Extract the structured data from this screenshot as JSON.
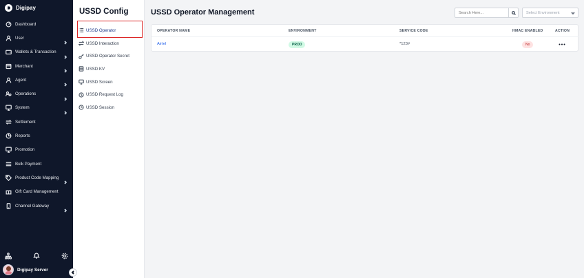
{
  "brand": {
    "name": "Digipay"
  },
  "sidebar": {
    "items": [
      {
        "label": "Dashboard",
        "icon": "speedometer-icon",
        "has_children": false
      },
      {
        "label": "User",
        "icon": "user-icon",
        "has_children": true
      },
      {
        "label": "Wallets & Transaction",
        "icon": "wallet-icon",
        "has_children": true
      },
      {
        "label": "Merchant",
        "icon": "store-icon",
        "has_children": true
      },
      {
        "label": "Agent",
        "icon": "agent-icon",
        "has_children": true
      },
      {
        "label": "Operations",
        "icon": "users-cog-icon",
        "has_children": true
      },
      {
        "label": "System",
        "icon": "monitor-icon",
        "has_children": true
      },
      {
        "label": "Settlement",
        "icon": "swap-icon",
        "has_children": false
      },
      {
        "label": "Reports",
        "icon": "pie-chart-icon",
        "has_children": false
      },
      {
        "label": "Promotion",
        "icon": "screen-icon",
        "has_children": false
      },
      {
        "label": "Bulk Payment",
        "icon": "list-icon",
        "has_children": false
      },
      {
        "label": "Product Code Mapping",
        "icon": "tag-icon",
        "has_children": true
      },
      {
        "label": "Gift Card Management",
        "icon": "gift-icon",
        "has_children": false
      },
      {
        "label": "Channel Gateway",
        "icon": "phone-icon",
        "has_children": true
      }
    ],
    "user_name": "Digipay Server"
  },
  "subpanel": {
    "title": "USSD Config",
    "items": [
      {
        "label": "USSD Operator",
        "icon": "list-icon",
        "active": true
      },
      {
        "label": "USSD Interaction",
        "icon": "swap-icon",
        "active": false
      },
      {
        "label": "USSD Operator Secret",
        "icon": "key-icon",
        "active": false
      },
      {
        "label": "USSD KV",
        "icon": "database-icon",
        "active": false
      },
      {
        "label": "USSD Screen",
        "icon": "monitor-icon",
        "active": false
      },
      {
        "label": "USSD Request Log",
        "icon": "history-icon",
        "active": false
      },
      {
        "label": "USSD Session",
        "icon": "clock-icon",
        "active": false
      }
    ]
  },
  "main": {
    "title": "USSD Operator Management",
    "search_placeholder": "Search Here...",
    "environment_placeholder": "Select Environment",
    "table": {
      "headers": [
        "OPERATOR NAME",
        "ENVIRONMENT",
        "SERVICE CODE",
        "HMAC ENABLED",
        "ACTION"
      ],
      "rows": [
        {
          "operator_name": "Airtel",
          "environment": "PROD",
          "service_code": "*123#",
          "hmac_enabled": "No"
        }
      ]
    }
  },
  "colors": {
    "sidebar_bg": "#0f172a",
    "accent_link": "#2563eb",
    "prod_badge": "#d1fae5",
    "no_badge": "#fee2e2",
    "highlight": "#dc2626"
  }
}
